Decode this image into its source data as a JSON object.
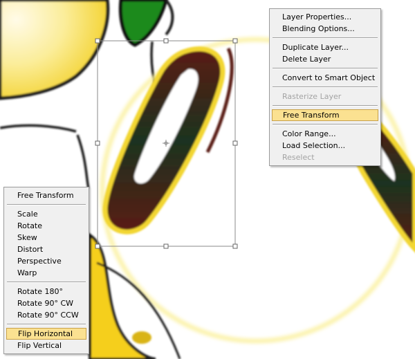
{
  "layer_context_menu": {
    "groups": [
      [
        {
          "label": "Layer Properties...",
          "enabled": true
        },
        {
          "label": "Blending Options...",
          "enabled": true
        }
      ],
      [
        {
          "label": "Duplicate Layer...",
          "enabled": true
        },
        {
          "label": "Delete Layer",
          "enabled": true
        }
      ],
      [
        {
          "label": "Convert to Smart Object",
          "enabled": true
        }
      ],
      [
        {
          "label": "Rasterize Layer",
          "enabled": false
        }
      ],
      [
        {
          "label": "Free Transform",
          "enabled": true,
          "highlighted": true
        }
      ],
      [
        {
          "label": "Color Range...",
          "enabled": true
        },
        {
          "label": "Load Selection...",
          "enabled": true
        },
        {
          "label": "Reselect",
          "enabled": false
        }
      ]
    ]
  },
  "transform_context_menu": {
    "groups": [
      [
        {
          "label": "Free Transform",
          "enabled": true
        }
      ],
      [
        {
          "label": "Scale",
          "enabled": true
        },
        {
          "label": "Rotate",
          "enabled": true
        },
        {
          "label": "Skew",
          "enabled": true
        },
        {
          "label": "Distort",
          "enabled": true
        },
        {
          "label": "Perspective",
          "enabled": true
        },
        {
          "label": "Warp",
          "enabled": true
        }
      ],
      [
        {
          "label": "Rotate 180°",
          "enabled": true
        },
        {
          "label": "Rotate 90° CW",
          "enabled": true
        },
        {
          "label": "Rotate 90° CCW",
          "enabled": true
        }
      ],
      [
        {
          "label": "Flip Horizontal",
          "enabled": true,
          "highlighted": true
        },
        {
          "label": "Flip Vertical",
          "enabled": true
        }
      ]
    ]
  },
  "colors": {
    "menu_background": "#f0f0f0",
    "highlight": "#fbe191",
    "highlight_border": "#c8a14a",
    "disabled_text": "#a3a3a3",
    "cartoon_yellow": "#f7d21c",
    "leaf_green": "#1f8a1f",
    "eye_dark": "#3a1a12",
    "outline": "#1a1a1a"
  }
}
